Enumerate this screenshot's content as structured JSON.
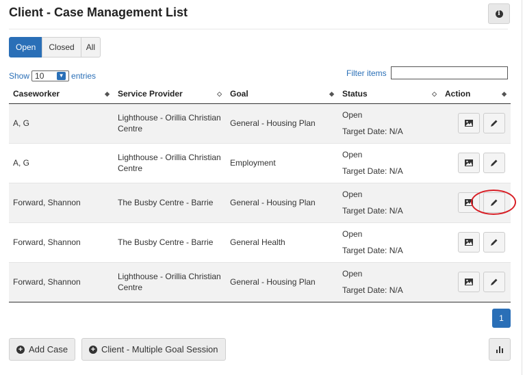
{
  "page": {
    "title": "Client - Case Management List",
    "info_icon": "info-icon"
  },
  "tabs": [
    {
      "label": "Open",
      "active": true
    },
    {
      "label": "Closed",
      "active": false
    },
    {
      "label": "All",
      "active": false
    }
  ],
  "length_control": {
    "prefix": "Show",
    "value": "10",
    "suffix": "entries"
  },
  "filter": {
    "label": "Filter items",
    "value": ""
  },
  "table": {
    "columns": [
      "Caseworker",
      "Service Provider",
      "Goal",
      "Status",
      "Action"
    ],
    "rows": [
      {
        "caseworker": "A, G",
        "provider": "Lighthouse - Orillia Christian Centre",
        "goal": "General - Housing Plan",
        "status": "Open",
        "target": "Target Date: N/A"
      },
      {
        "caseworker": "A, G",
        "provider": "Lighthouse - Orillia Christian Centre",
        "goal": "Employment",
        "status": "Open",
        "target": "Target Date: N/A"
      },
      {
        "caseworker": "Forward, Shannon",
        "provider": "The Busby Centre - Barrie",
        "goal": "General - Housing Plan",
        "status": "Open",
        "target": "Target Date: N/A"
      },
      {
        "caseworker": "Forward, Shannon",
        "provider": "The Busby Centre - Barrie",
        "goal": "General Health",
        "status": "Open",
        "target": "Target Date: N/A"
      },
      {
        "caseworker": "Forward, Shannon",
        "provider": "Lighthouse - Orillia Christian Centre",
        "goal": "General - Housing Plan",
        "status": "Open",
        "target": "Target Date: N/A"
      }
    ],
    "row_actions": [
      "image-icon",
      "pencil-icon"
    ]
  },
  "pagination": {
    "current": "1"
  },
  "buttons": {
    "add_case": "Add Case",
    "multiple_goal_session": "Client - Multiple Goal Session",
    "chart_icon": "bar-chart-icon"
  },
  "colors": {
    "primary": "#2a6fb7",
    "annotation": "#d81f26"
  }
}
